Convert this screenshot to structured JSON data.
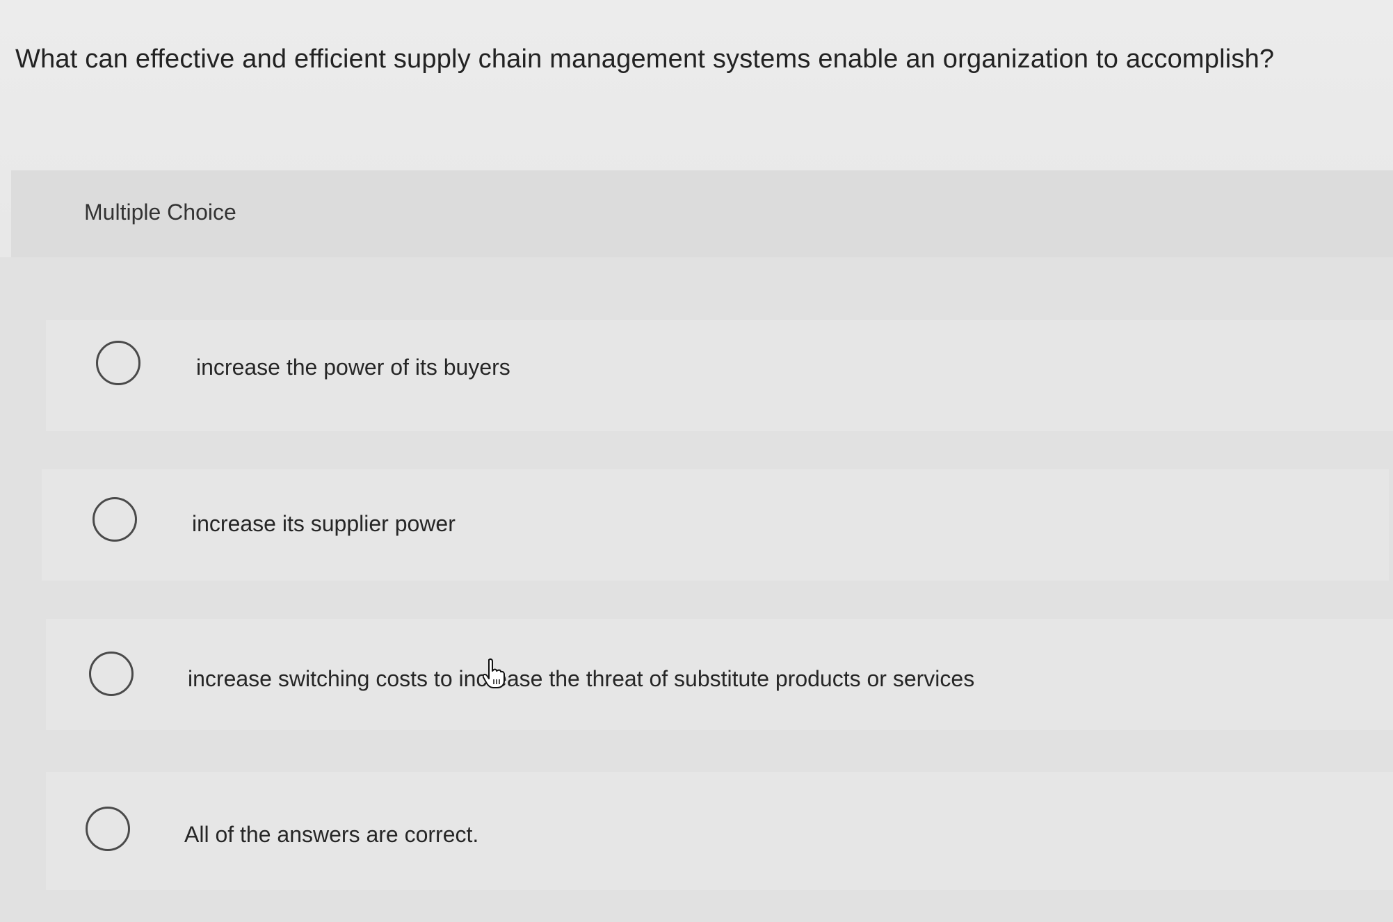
{
  "question": {
    "text": "What can effective and efficient supply chain management systems enable an organization to accomplish?"
  },
  "section": {
    "label": "Multiple Choice"
  },
  "options": [
    {
      "label": "increase the power of its buyers",
      "selected": false
    },
    {
      "label": "increase its supplier power",
      "selected": false
    },
    {
      "label": "increase switching costs to increase the threat of substitute products or services",
      "selected": false
    },
    {
      "label": "All of the answers are correct.",
      "selected": false
    }
  ],
  "cursor": {
    "icon": "hand-pointer-icon"
  }
}
